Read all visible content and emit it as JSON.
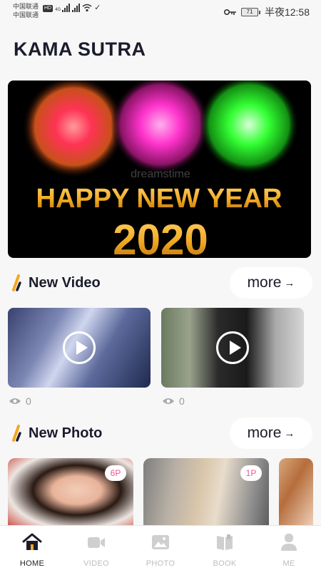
{
  "status_bar": {
    "carrier_1": "中国联通",
    "carrier_2": "中国联通",
    "hd_badge": "HD",
    "net_label": "4G",
    "battery": "71",
    "time": "半夜12:58",
    "icons": [
      "signal-icon",
      "wifi-icon",
      "key-icon",
      "battery-icon"
    ]
  },
  "app": {
    "title": "KAMA SUTRA"
  },
  "banner": {
    "text_line_1": "HAPPY NEW YEAR",
    "text_line_2": "2020",
    "watermark": "dreamstime",
    "colors": {
      "firework_1": "#ff3355",
      "firework_2": "#ff33cc",
      "firework_3": "#33ff33",
      "text_gold": "#f0a820"
    }
  },
  "sections": {
    "video": {
      "title": "New Video",
      "more_label": "more"
    },
    "photo": {
      "title": "New Photo",
      "more_label": "more"
    }
  },
  "videos": [
    {
      "views": "0"
    },
    {
      "views": "0"
    }
  ],
  "photos": [
    {
      "badge": "6P"
    },
    {
      "badge": "1P"
    },
    {
      "badge": ""
    }
  ],
  "bottom_nav": [
    {
      "label": "HOME",
      "icon": "home-icon",
      "active": true
    },
    {
      "label": "VIDEO",
      "icon": "video-icon",
      "active": false
    },
    {
      "label": "PHOTO",
      "icon": "photo-icon",
      "active": false
    },
    {
      "label": "BOOK",
      "icon": "book-icon",
      "active": false
    },
    {
      "label": "ME",
      "icon": "profile-icon",
      "active": false
    }
  ],
  "colors": {
    "accent_orange": "#f5a623",
    "accent_dark": "#1b1c2b",
    "badge_pink": "#f0578b"
  }
}
